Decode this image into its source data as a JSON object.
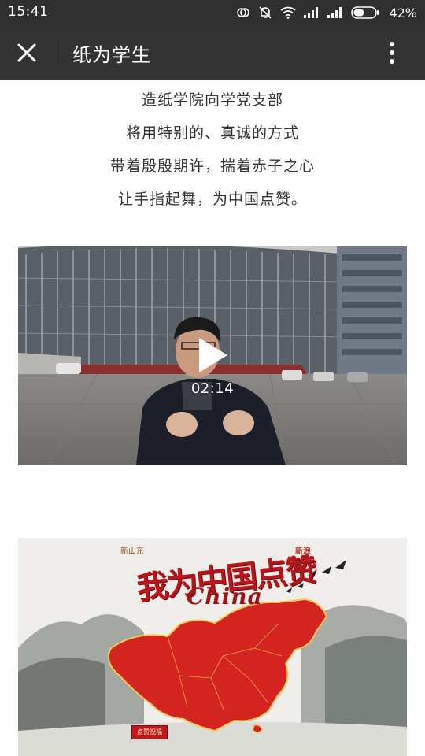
{
  "status_bar": {
    "time": "15:41",
    "battery_percent": "42%",
    "icons": [
      "sync-icon",
      "mute-icon",
      "wifi-icon",
      "signal-icon",
      "signal-icon",
      "battery-icon"
    ]
  },
  "app_bar": {
    "title": "纸为学生",
    "close_icon": "close-icon",
    "more_icon": "more-vertical-icon",
    "background": "#333333"
  },
  "article": {
    "lines": [
      "造纸学院向学党支部",
      "将用特别的、真诚的方式",
      "带着殷殷期许，揣着赤子之心",
      "让手指起舞，为中国点赞。"
    ]
  },
  "video": {
    "duration": "02:14",
    "play_icon": "play-icon"
  },
  "poster": {
    "title": "我为中国点赞",
    "subtitle": "China",
    "logo_left": "新山东",
    "logo_right": "新浪",
    "button_label": "点赞祝福",
    "accent_color": "#b7141b"
  }
}
